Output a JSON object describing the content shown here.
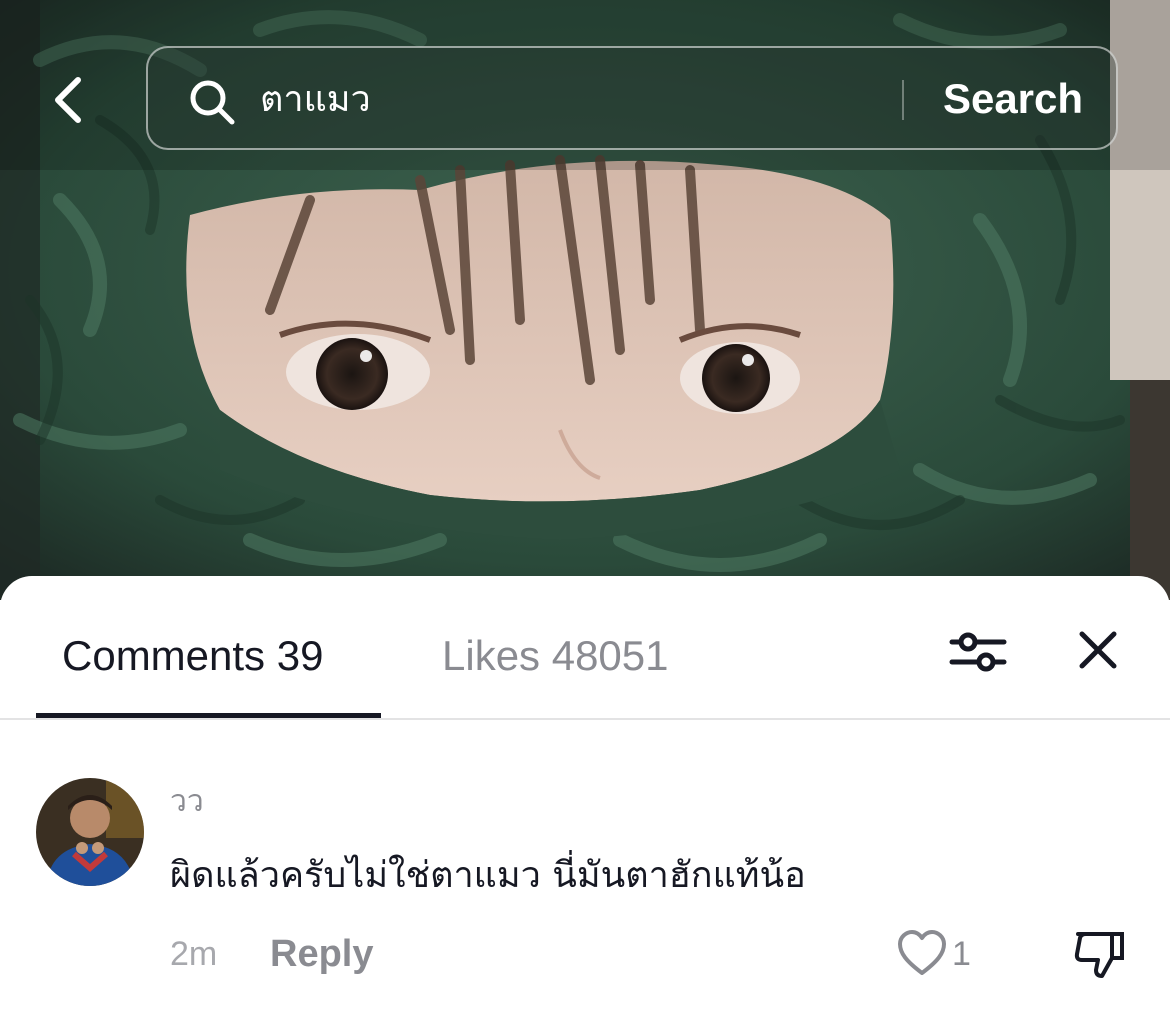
{
  "search": {
    "query": "ตาแมว",
    "button_label": "Search"
  },
  "sheet": {
    "tabs": [
      {
        "label": "Comments 39",
        "active": true
      },
      {
        "label": "Likes 48051",
        "active": false
      }
    ]
  },
  "comments": [
    {
      "username": "วว",
      "text": "ผิดแล้วครับไม่ใช่ตาแมว นี่มันตาฮักแท้น้อ",
      "time": "2m",
      "reply_label": "Reply",
      "like_count": "1"
    }
  ],
  "icons": {
    "back": "chevron-left-icon",
    "search": "search-icon",
    "filter": "sliders-icon",
    "close": "close-icon",
    "like": "heart-outline-icon",
    "dislike": "thumbs-down-icon"
  },
  "colors": {
    "primary_text": "#161823",
    "secondary_text": "#8a8b91",
    "scarf_green": "#2f5a45"
  }
}
